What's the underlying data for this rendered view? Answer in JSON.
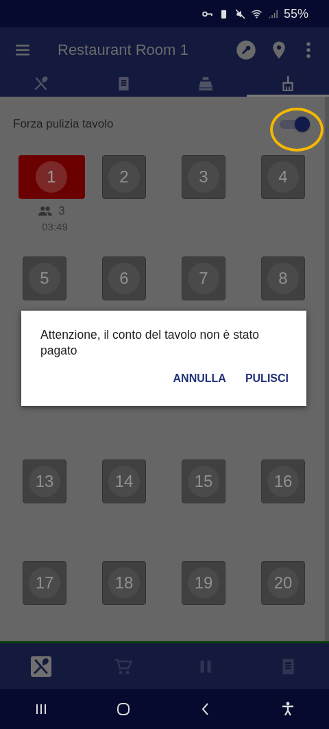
{
  "status_bar": {
    "battery": "55%"
  },
  "app_bar": {
    "title": "Restaurant Room 1"
  },
  "tabs": [
    {
      "kind": "cutlery",
      "selected": false
    },
    {
      "kind": "receipt",
      "selected": false
    },
    {
      "kind": "register",
      "selected": false
    },
    {
      "kind": "broom",
      "selected": true
    }
  ],
  "force_clean": {
    "label": "Forza pulizia tavolo",
    "on": true,
    "highlighted": true
  },
  "table_rows": [
    {
      "tables": [
        {
          "number": "1",
          "occupied": true,
          "guests": "3",
          "time": "03:49"
        },
        {
          "number": "2",
          "occupied": false
        },
        {
          "number": "3",
          "occupied": false
        },
        {
          "number": "4",
          "occupied": false
        }
      ]
    },
    {
      "tables": [
        {
          "number": "5",
          "occupied": false
        },
        {
          "number": "6",
          "occupied": false
        },
        {
          "number": "7",
          "occupied": false
        },
        {
          "number": "8",
          "occupied": false
        }
      ]
    },
    {
      "tables": [
        {
          "number": "13",
          "occupied": false
        },
        {
          "number": "14",
          "occupied": false
        },
        {
          "number": "15",
          "occupied": false
        },
        {
          "number": "16",
          "occupied": false
        }
      ]
    },
    {
      "tables": [
        {
          "number": "17",
          "occupied": false
        },
        {
          "number": "18",
          "occupied": false
        },
        {
          "number": "19",
          "occupied": false
        },
        {
          "number": "20",
          "occupied": false
        }
      ]
    }
  ],
  "dialog": {
    "message": "Attenzione, il conto del tavolo non è stato pagato",
    "buttons": [
      "ANNULLA",
      "PULISCI"
    ]
  },
  "bottom_nav": [
    {
      "kind": "cutlery",
      "selected": true
    },
    {
      "kind": "cart",
      "selected": false
    },
    {
      "kind": "pause",
      "selected": false
    },
    {
      "kind": "receipt",
      "selected": false
    }
  ]
}
